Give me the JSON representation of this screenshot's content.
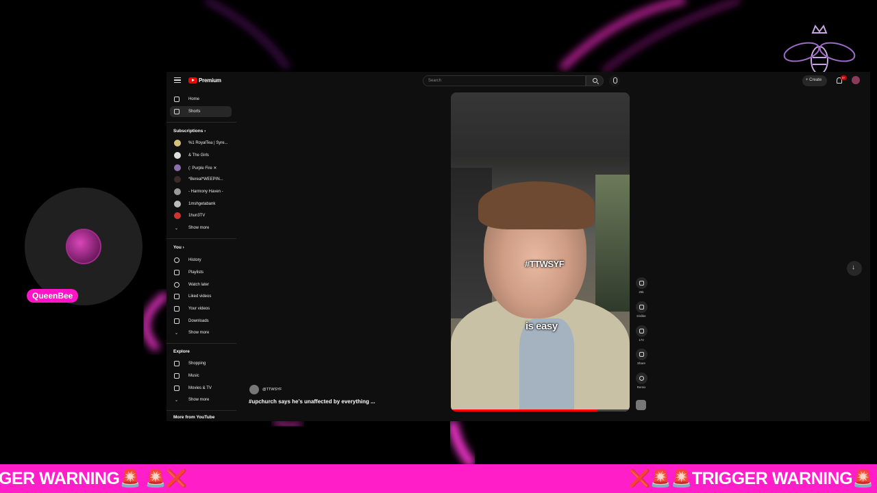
{
  "overlay": {
    "streamer_name": "QueenBee",
    "ticker_left": "GER WARNING🚨 🚨❌",
    "ticker_right": "❌🚨🚨TRIGGER WARNING🚨",
    "colors": {
      "accent": "#ff1ec8",
      "background": "#000000"
    }
  },
  "browser": {
    "brand": "Premium",
    "search_placeholder": "Search",
    "create_label": "Create",
    "notifications_count": "9+",
    "sidebar": {
      "primary": [
        {
          "label": "Home",
          "icon": "home-icon"
        },
        {
          "label": "Shorts",
          "icon": "shorts-icon",
          "active": true
        }
      ],
      "subscriptions_heading": "Subscriptions",
      "subscriptions": [
        {
          "label": "%1 RoyalTea | Syre..."
        },
        {
          "label": "& The Girls"
        },
        {
          "label": "(: Purple Fire ✕"
        },
        {
          "label": "*Bereal*WEEPIN..."
        },
        {
          "label": "- Harmony Haven -"
        },
        {
          "label": "1mshgetabank"
        },
        {
          "label": "1hun3TV"
        }
      ],
      "subs_show_more": "Show more",
      "you_heading": "You",
      "you_items": [
        {
          "label": "History",
          "icon": "history-icon"
        },
        {
          "label": "Playlists",
          "icon": "playlists-icon"
        },
        {
          "label": "Watch later",
          "icon": "clock-icon"
        },
        {
          "label": "Liked videos",
          "icon": "thumbs-up-icon"
        },
        {
          "label": "Your videos",
          "icon": "video-icon"
        },
        {
          "label": "Downloads",
          "icon": "download-icon"
        }
      ],
      "you_show_more": "Show more",
      "explore_heading": "Explore",
      "explore_items": [
        {
          "label": "Shopping",
          "icon": "bag-icon"
        },
        {
          "label": "Music",
          "icon": "music-icon"
        },
        {
          "label": "Movies & TV",
          "icon": "film-icon"
        }
      ],
      "explore_show_more": "Show more",
      "more_heading": "More from YouTube"
    },
    "short": {
      "caption_top": "#TTWSYF",
      "caption_bottom": "is easy",
      "channel_handle": "@TTWSYF",
      "title": "#upchurch says he's unaffected by everything ...",
      "progress": 0.82,
      "actions": [
        {
          "name": "like",
          "label": "25k",
          "icon": "thumbs-up-icon"
        },
        {
          "name": "dislike",
          "label": "Dislike",
          "icon": "thumbs-down-icon"
        },
        {
          "name": "comments",
          "label": "172",
          "icon": "comment-icon"
        },
        {
          "name": "share",
          "label": "Share",
          "icon": "share-icon"
        },
        {
          "name": "remix",
          "label": "Remix",
          "icon": "remix-icon"
        }
      ]
    }
  }
}
